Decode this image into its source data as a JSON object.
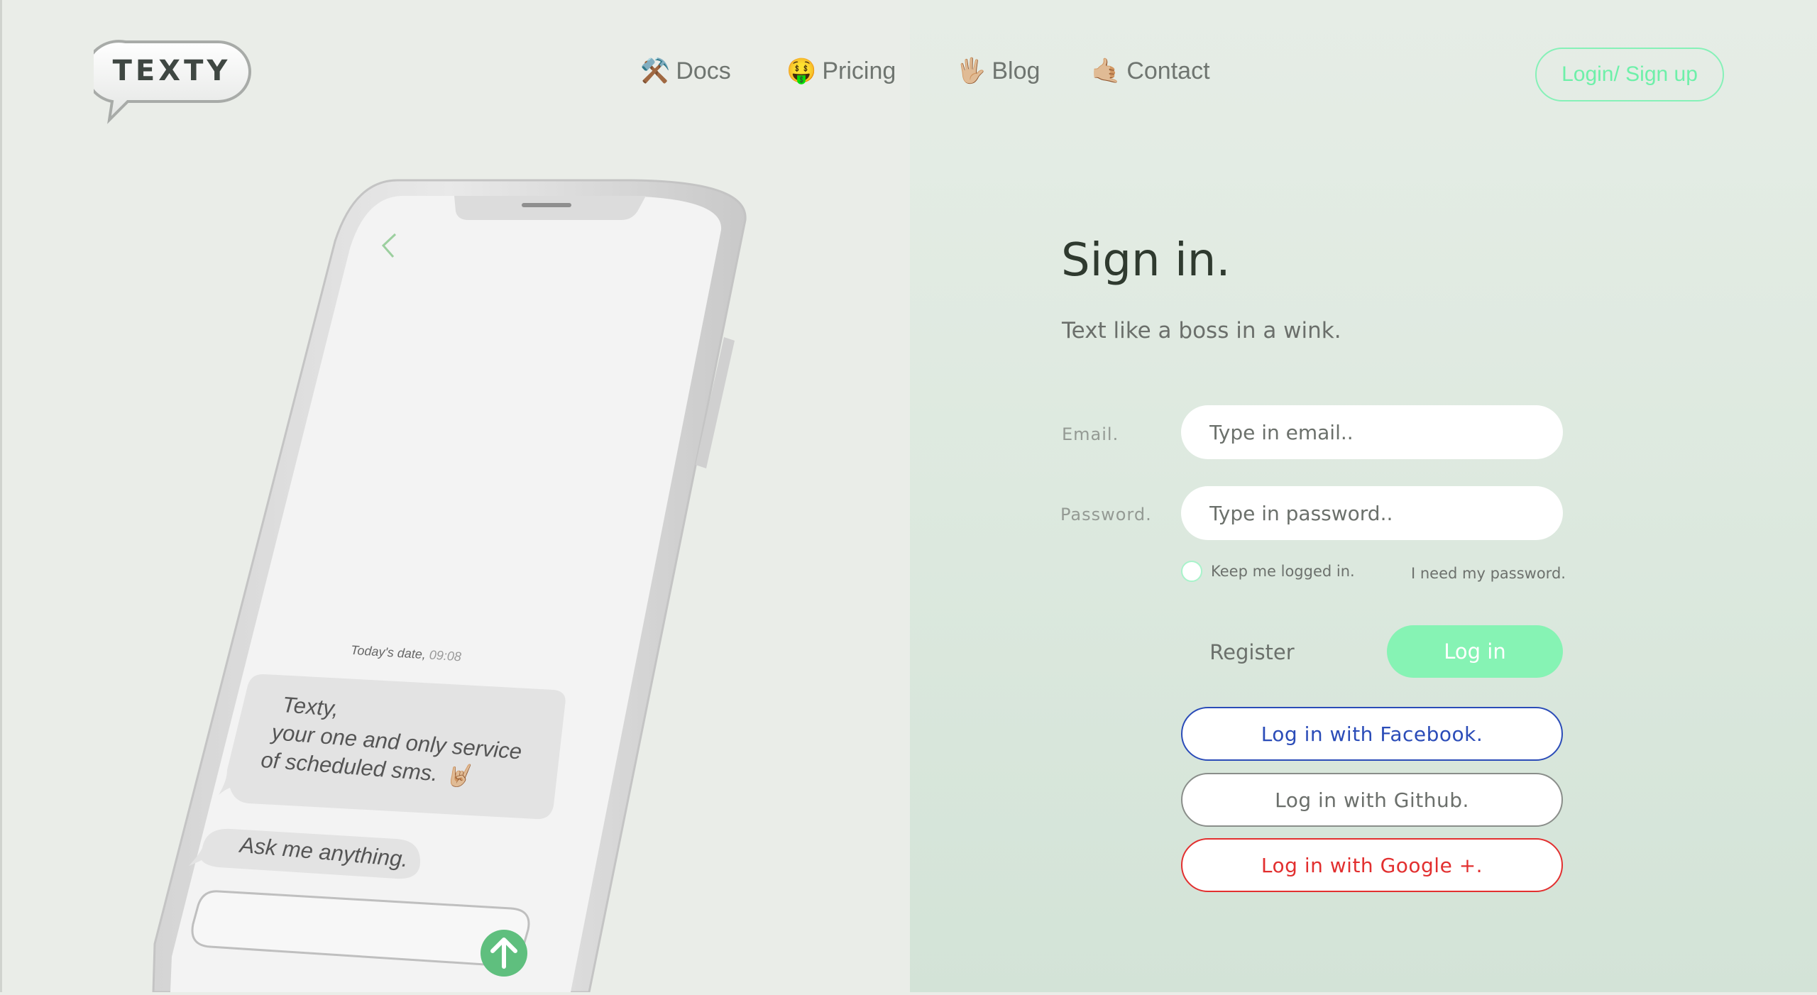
{
  "header": {
    "logo_text": "TEXTY",
    "nav": [
      {
        "icon": "hammer-and-pick-icon",
        "emoji": "⚒️",
        "label": "Docs"
      },
      {
        "icon": "money-mouth-face-icon",
        "emoji": "🤑",
        "label": "Pricing"
      },
      {
        "icon": "raised-hand-icon",
        "emoji": "🖐🏼",
        "label": "Blog"
      },
      {
        "icon": "call-me-hand-icon",
        "emoji": "🤙🏼",
        "label": "Contact"
      }
    ],
    "login_signup_label": "Login/ Sign up"
  },
  "phone": {
    "date_label": "Today's date,",
    "time_label": "09:08",
    "message_1_line_1": "Texty,",
    "message_1_line_2": "your one and only service",
    "message_1_line_3": "of scheduled sms.",
    "message_1_emoji": "🤘🏼",
    "message_2": "Ask me anything."
  },
  "signin": {
    "title": "Sign in.",
    "subtitle": "Text like a boss in a wink.",
    "email_label": "Email.",
    "email_placeholder": "Type in email..",
    "password_label": "Password.",
    "password_placeholder": "Type in password..",
    "keep_logged_in": "Keep me logged in.",
    "forgot_password": "I need my password.",
    "register_label": "Register",
    "login_label": "Log in",
    "facebook_label": "Log in with Facebook.",
    "github_label": "Log in with Github.",
    "google_label": "Log in with Google +."
  },
  "colors": {
    "accent_green": "#86f3b4",
    "facebook_blue": "#2b4cb8",
    "google_red": "#e22f2f",
    "github_gray": "#6b6f6b"
  }
}
